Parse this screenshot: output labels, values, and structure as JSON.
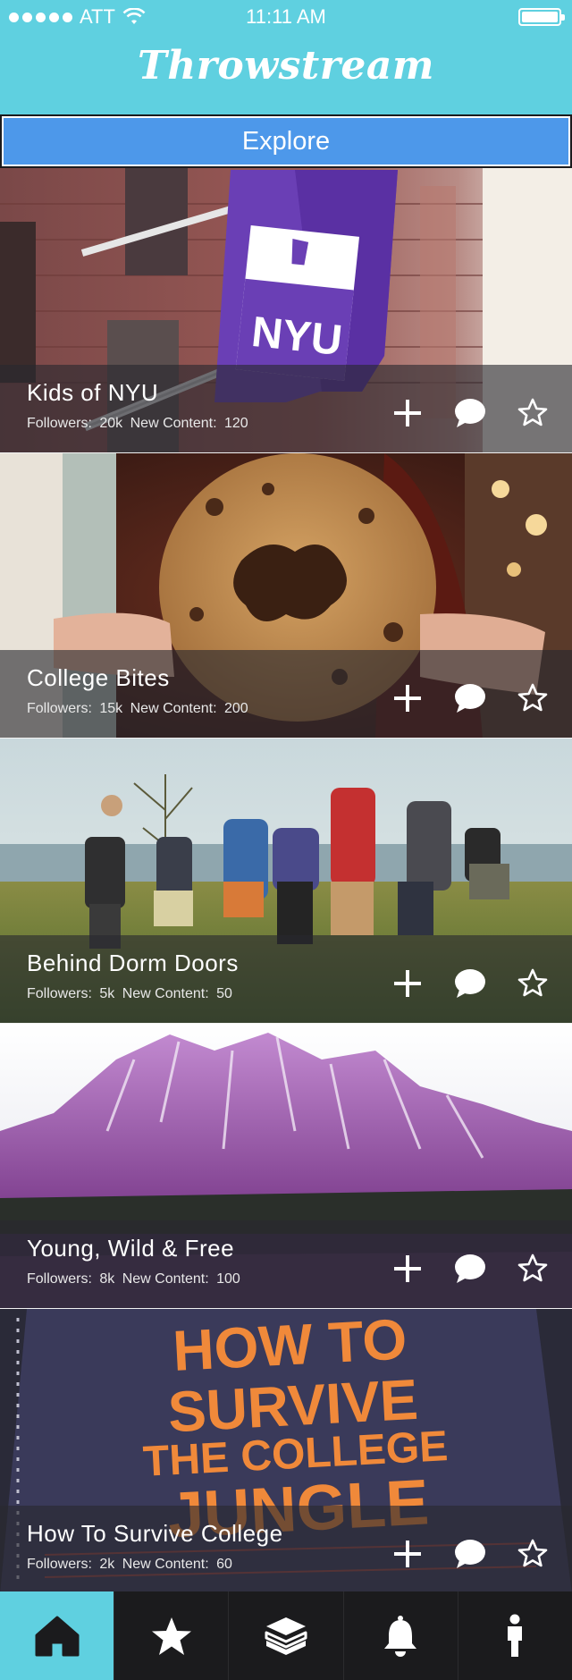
{
  "status_bar": {
    "carrier": "ATT",
    "time": "11:11 AM"
  },
  "header": {
    "app_title": "Throwstream"
  },
  "explore_button": {
    "label": "Explore"
  },
  "labels": {
    "followers": "Followers:",
    "new_content": "New Content:"
  },
  "streams": [
    {
      "title": "Kids of NYU",
      "followers": "20k",
      "new_content": "120",
      "image": "nyu-flag-photo"
    },
    {
      "title": "College Bites",
      "followers": "15k",
      "new_content": "200",
      "image": "cookie-photo"
    },
    {
      "title": "Behind Dorm Doors",
      "followers": "5k",
      "new_content": "50",
      "image": "backpackers-photo"
    },
    {
      "title": "Young, Wild & Free",
      "followers": "8k",
      "new_content": "100",
      "image": "mountain-photo"
    },
    {
      "title": "How To Survive College",
      "followers": "2k",
      "new_content": "60",
      "image": "book-photo"
    }
  ],
  "book_cover": {
    "line1": "HOW TO",
    "line2": "SURVIVE",
    "line3": "THE COLLEGE",
    "line4": "JUNGLE"
  },
  "nyu_flag": {
    "text": "NYU"
  },
  "tab_bar": {
    "items": [
      {
        "icon": "home-icon",
        "active": true
      },
      {
        "icon": "star-icon",
        "active": false
      },
      {
        "icon": "boxes-icon",
        "active": false
      },
      {
        "icon": "bell-icon",
        "active": false
      },
      {
        "icon": "person-icon",
        "active": false
      }
    ]
  },
  "colors": {
    "header": "#5fd0e0",
    "explore": "#4d98ea",
    "tabbar": "#1b1b1d",
    "active_tab": "#5fd0e0"
  }
}
